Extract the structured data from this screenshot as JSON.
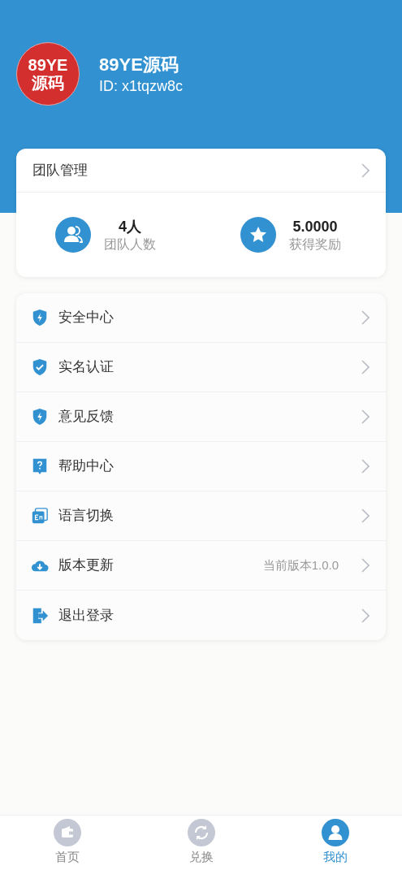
{
  "profile": {
    "avatar_lines": [
      "89YE",
      "源码"
    ],
    "name": "89YE源码",
    "id": "ID: x1tqzw8c"
  },
  "team": {
    "title": "团队管理",
    "stats": [
      {
        "kind": "people",
        "value": "4人",
        "label": "团队人数"
      },
      {
        "kind": "star",
        "value": "5.0000",
        "label": "获得奖励"
      }
    ]
  },
  "menu": [
    {
      "kind": "shield-bolt",
      "label": "安全中心"
    },
    {
      "kind": "shield-check",
      "label": "实名认证"
    },
    {
      "kind": "shield-bolt",
      "label": "意见反馈"
    },
    {
      "kind": "help",
      "label": "帮助中心"
    },
    {
      "kind": "language",
      "label": "语言切换"
    },
    {
      "kind": "cloud",
      "label": "版本更新",
      "detail": "当前版本1.0.0"
    },
    {
      "kind": "logout",
      "label": "退出登录"
    }
  ],
  "tabs": [
    {
      "kind": "wallet",
      "label": "首页",
      "selected": false
    },
    {
      "kind": "refresh",
      "label": "兑换",
      "selected": false
    },
    {
      "kind": "user",
      "label": "我的",
      "selected": true
    }
  ]
}
